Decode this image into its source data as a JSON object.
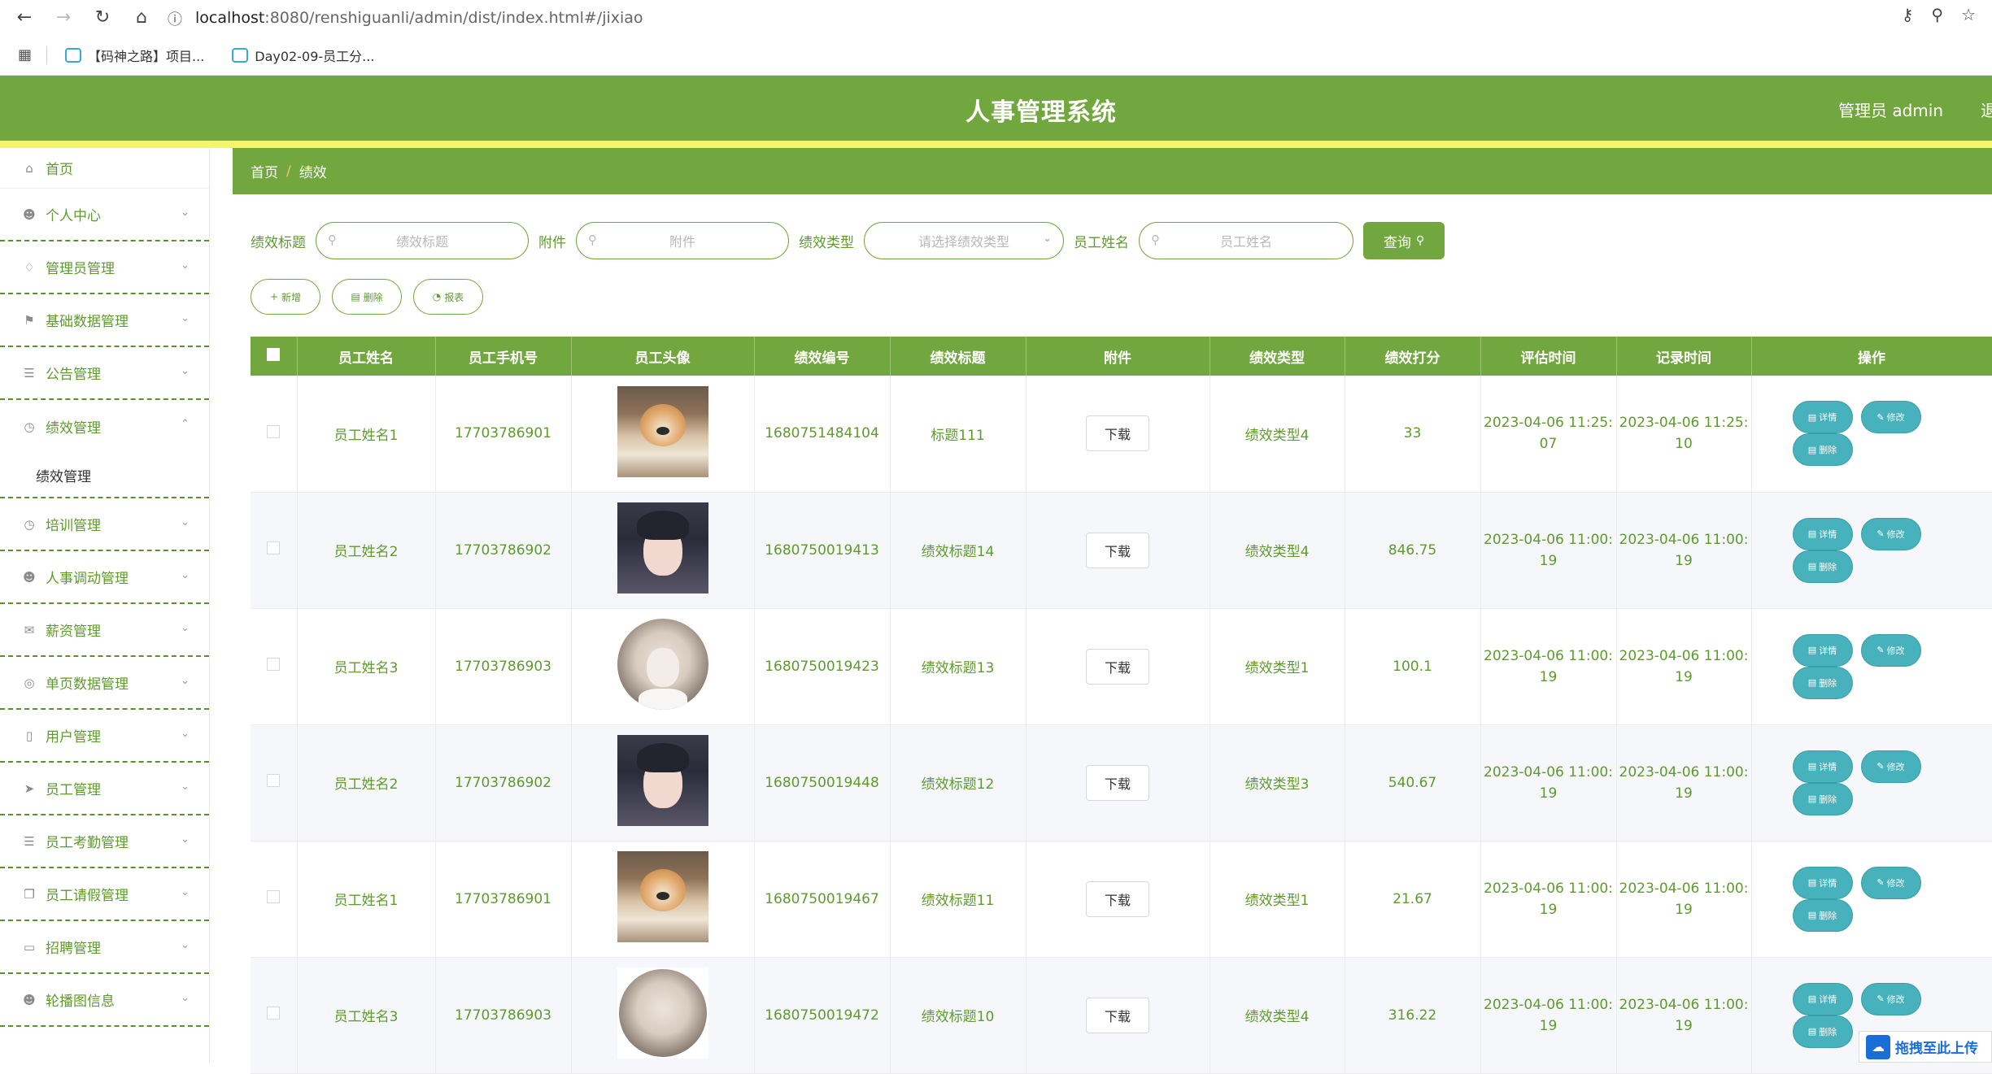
{
  "browser": {
    "url_host": "localhost",
    "url_rest": ":8080/renshiguanli/admin/dist/index.html#/jixiao",
    "bookmarks": [
      "【码神之路】项目...",
      "Day02-09-员工分..."
    ]
  },
  "header": {
    "title": "人事管理系统",
    "user": "管理员 admin",
    "logout": "退"
  },
  "sidebar": {
    "home": "首页",
    "items": [
      {
        "label": "个人中心",
        "icon": "user-icon"
      },
      {
        "label": "管理员管理",
        "icon": "bell-off-icon"
      },
      {
        "label": "基础数据管理",
        "icon": "flag-icon"
      },
      {
        "label": "公告管理",
        "icon": "list-icon"
      },
      {
        "label": "绩效管理",
        "icon": "compass-icon",
        "open": true,
        "sub": "绩效管理"
      },
      {
        "label": "培训管理",
        "icon": "compass-icon"
      },
      {
        "label": "人事调动管理",
        "icon": "user-icon"
      },
      {
        "label": "薪资管理",
        "icon": "mail-icon"
      },
      {
        "label": "单页数据管理",
        "icon": "globe-icon"
      },
      {
        "label": "用户管理",
        "icon": "phone-icon"
      },
      {
        "label": "员工管理",
        "icon": "send-icon"
      },
      {
        "label": "员工考勤管理",
        "icon": "list-icon"
      },
      {
        "label": "员工请假管理",
        "icon": "copy-icon"
      },
      {
        "label": "招聘管理",
        "icon": "card-icon"
      },
      {
        "label": "轮播图信息",
        "icon": "user-icon"
      }
    ]
  },
  "breadcrumb": {
    "home": "首页",
    "sep": "/",
    "current": "绩效"
  },
  "search": {
    "title_label": "绩效标题",
    "title_placeholder": "绩效标题",
    "file_label": "附件",
    "file_placeholder": "附件",
    "type_label": "绩效类型",
    "type_placeholder": "请选择绩效类型",
    "name_label": "员工姓名",
    "name_placeholder": "员工姓名",
    "query_btn": "查询"
  },
  "actions": {
    "add": "新增",
    "delete": "删除",
    "report": "报表"
  },
  "table": {
    "headers": [
      "员工姓名",
      "员工手机号",
      "员工头像",
      "绩效编号",
      "绩效标题",
      "附件",
      "绩效类型",
      "绩效打分",
      "评估时间",
      "记录时间",
      "操作"
    ],
    "download": "下载",
    "op_detail": "详情",
    "op_edit": "修改",
    "op_delete": "删除",
    "rows": [
      {
        "name": "员工姓名1",
        "phone": "17703786901",
        "avatar": "dog",
        "code": "1680751484104",
        "title": "标题111",
        "type": "绩效类型4",
        "score": "33",
        "eval1": "2023-04-06 11:25:",
        "eval2": "07",
        "rec1": "2023-04-06 11:25:",
        "rec2": "10"
      },
      {
        "name": "员工姓名2",
        "phone": "17703786902",
        "avatar": "girl",
        "code": "1680750019413",
        "title": "绩效标题14",
        "type": "绩效类型4",
        "score": "846.75",
        "eval1": "2023-04-06 11:00:",
        "eval2": "19",
        "rec1": "2023-04-06 11:00:",
        "rec2": "19"
      },
      {
        "name": "员工姓名3",
        "phone": "17703786903",
        "avatar": "sketch",
        "code": "1680750019423",
        "title": "绩效标题13",
        "type": "绩效类型1",
        "score": "100.1",
        "eval1": "2023-04-06 11:00:",
        "eval2": "19",
        "rec1": "2023-04-06 11:00:",
        "rec2": "19"
      },
      {
        "name": "员工姓名2",
        "phone": "17703786902",
        "avatar": "girl",
        "code": "1680750019448",
        "title": "绩效标题12",
        "type": "绩效类型3",
        "score": "540.67",
        "eval1": "2023-04-06 11:00:",
        "eval2": "19",
        "rec1": "2023-04-06 11:00:",
        "rec2": "19"
      },
      {
        "name": "员工姓名1",
        "phone": "17703786901",
        "avatar": "dog",
        "code": "1680750019467",
        "title": "绩效标题11",
        "type": "绩效类型1",
        "score": "21.67",
        "eval1": "2023-04-06 11:00:",
        "eval2": "19",
        "rec1": "2023-04-06 11:00:",
        "rec2": "19"
      },
      {
        "name": "员工姓名3",
        "phone": "17703786903",
        "avatar": "sketch-sq",
        "code": "1680750019472",
        "title": "绩效标题10",
        "type": "绩效类型4",
        "score": "316.22",
        "eval1": "2023-04-06 11:00:",
        "eval2": "19",
        "rec1": "2023-04-06 11:00:",
        "rec2": "19"
      }
    ]
  },
  "upload_tag": "拖拽至此上传",
  "colors": {
    "primary": "#72a73f",
    "accent_strip": "#f5f56a",
    "op_button": "#47b2bc",
    "text_green": "#5f9a2f"
  }
}
